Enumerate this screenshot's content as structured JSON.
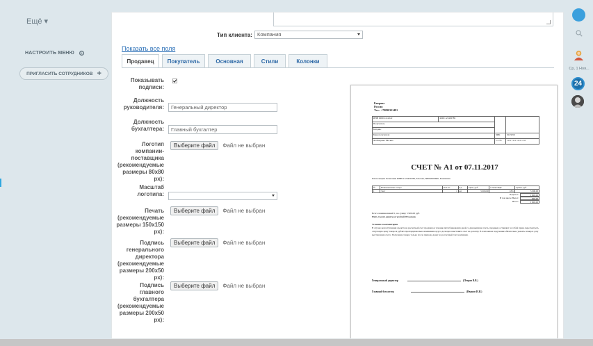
{
  "sidebar": {
    "more": "Ещё ▾",
    "setup_menu": "НАСТРОИТЬ МЕНЮ",
    "invite": "ПРИГЛАСИТЬ СОТРУДНИКОВ"
  },
  "form": {
    "client_type_label": "Тип клиента:",
    "client_type_value": "Компания",
    "show_all": "Показать все поля",
    "tabs": [
      "Продавец",
      "Покупатель",
      "Основная",
      "Стили",
      "Колонки"
    ],
    "show_signatures_label": "Показывать подписи:",
    "director_position_label": "Должность руководителя:",
    "director_position_placeholder": "Генеральный директор",
    "accountant_position_label": "Должность бухгалтера:",
    "accountant_position_placeholder": "Главный бухгалтер",
    "logo_label": "Логотип компании-поставщика (рекомендуемые размеры 80х80 px):",
    "logo_scale_label": "Масштаб логотипа:",
    "stamp_label": "Печать (рекомендуемые размеры 150х150 px):",
    "director_sign_label": "Подпись генерального директора (рекомендуемые размеры 200х50 px):",
    "accountant_sign_label": "Подпись главного бухгалтера (рекомендуемые размеры 200х50 px):",
    "choose_file": "Выберите файл",
    "no_file": "Файл не выбран"
  },
  "invoice": {
    "company": "Битрикс",
    "country": "Россия",
    "phone": "Тел.: +79090321481",
    "inn": "ИНН 000011112222",
    "kpp": "КПП 123456789",
    "recipient": "Получатель",
    "bitrix": "Битрикс",
    "acc_label": "Сч. №",
    "acc_value": "0000 0000 0000 0000 0000",
    "bank_recipient": "Банк получателя",
    "bik_label": "БИК",
    "bik_value": "0123456",
    "bank_name": "АО Битрикс Москва",
    "corr_value": "1111 1111 1111 1111",
    "title": "СЧЕТ № A1 от 07.11.2017",
    "payer": "Плательщик: Компания ИНН 0123456789, Москва, 88002000600, Компания",
    "item_headers": [
      "№",
      "Наименование товара",
      "Кол-во",
      "Ед.",
      "Цена, руб.",
      "Ставка НДС",
      "Сумма, руб."
    ],
    "item_row": [
      "1",
      "Тест",
      "1",
      "шт",
      "5 000.00",
      "18%",
      "5 900.00"
    ],
    "totals": [
      {
        "label": "Подытог:",
        "value": "5 000.00"
      },
      {
        "label": "В том числе Налог:",
        "value": "900.00"
      },
      {
        "label": "Итого:",
        "value": "5 900.00"
      }
    ],
    "total_line": "Всего наименований 1, на сумму 5 900.00 руб.",
    "total_words": "Пять тысяч девятьсот рублей 00 копеек",
    "conditions_title": "Условия и комментарии",
    "conditions_text": "В случае непоступления средств на расчетный счет продавца в течение пяти банковских дней со дня выписки счета, продавец оставляет за собой право пересмотреть отпускную цену товара в рублях пропорционально изменению курса доллара и выставить счет на доплату. В платежном поручении обязательно указать номер и дату выставления счета. Получение товара только после прихода денег на расчетный счет компании.",
    "director_title": "Генеральный директор",
    "director_name": "(Петров В.В.)",
    "accountant_title": "Главный бухгалтер",
    "accountant_name": "(Иванов И.И.)"
  },
  "rightbar": {
    "date": "Ср, 1 Ноя...",
    "count": "24"
  },
  "colors": {
    "link_blue": "#2a6fb7",
    "badge_blue": "#1d6fa8",
    "page_bg": "#dde7ec"
  }
}
